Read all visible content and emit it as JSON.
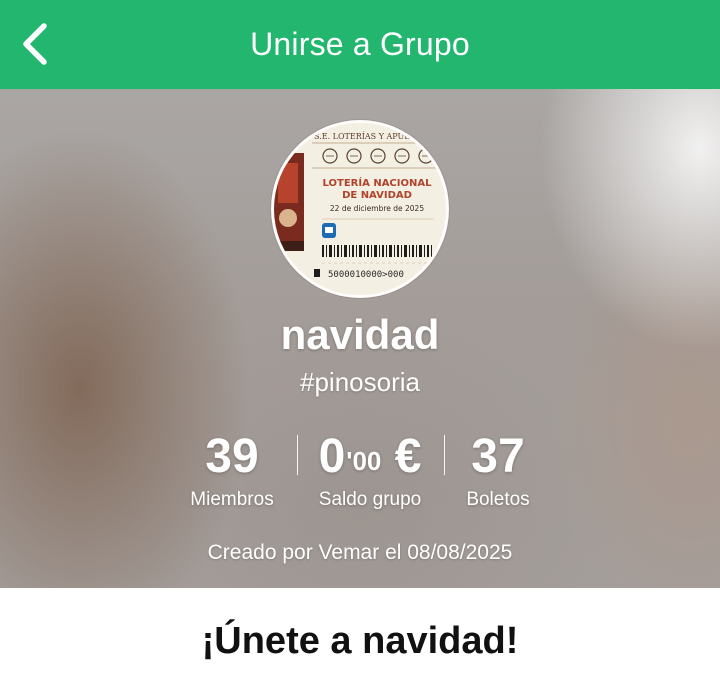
{
  "header": {
    "title": "Unirse a Grupo",
    "back_icon": "chevron-left-icon",
    "background": "#22b66f"
  },
  "group": {
    "avatar": {
      "issuer": "S.E. LOTERÍAS Y APUESTAS DEL ESTADO",
      "ticket_title_line1": "LOTERÍA NACIONAL",
      "ticket_title_line2": "DE NAVIDAD",
      "ticket_date": "22 de diciembre de 2025",
      "ticket_number": "5000010000>000"
    },
    "name": "navidad",
    "tag": "#pinosoria",
    "stats": {
      "members_value": "39",
      "members_label": "Miembros",
      "balance_integer": "0",
      "balance_decimals": "'00",
      "balance_currency": " €",
      "balance_label": "Saldo grupo",
      "tickets_value": "37",
      "tickets_label": "Boletos"
    },
    "created_text": "Creado por Vemar el 08/08/2025"
  },
  "join": {
    "title": "¡Únete a navidad!"
  }
}
